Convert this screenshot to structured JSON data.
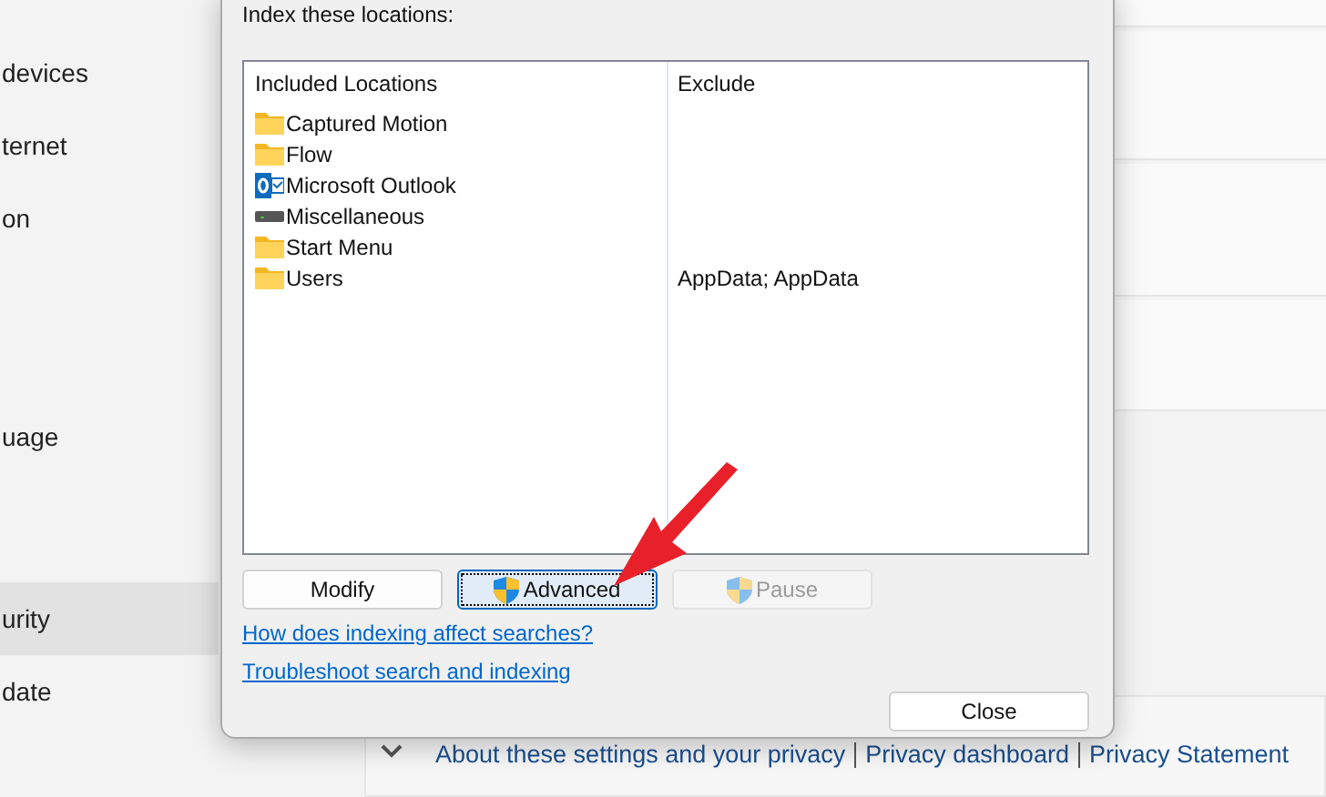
{
  "sidebar": {
    "items": [
      {
        "label": "devices",
        "selected": false
      },
      {
        "label": "ternet",
        "selected": false
      },
      {
        "label": "on",
        "selected": false
      },
      {
        "label": "uage",
        "selected": false
      },
      {
        "label": "urity",
        "selected": true
      },
      {
        "label": "date",
        "selected": false
      }
    ]
  },
  "dialog": {
    "heading": "Index these locations:",
    "columns": [
      "Included Locations",
      "Exclude"
    ],
    "rows": [
      {
        "kind": "folder",
        "location": "Captured Motion",
        "exclude": ""
      },
      {
        "kind": "folder",
        "location": "Flow",
        "exclude": ""
      },
      {
        "kind": "outlook",
        "location": "Microsoft Outlook",
        "exclude": ""
      },
      {
        "kind": "drive",
        "location": "Miscellaneous",
        "exclude": ""
      },
      {
        "kind": "folder",
        "location": "Start Menu",
        "exclude": ""
      },
      {
        "kind": "folder",
        "location": "Users",
        "exclude": "AppData; AppData"
      }
    ],
    "buttons": [
      {
        "label": "Modify",
        "shield": false,
        "disabled": false,
        "focused": false
      },
      {
        "label": "Advanced",
        "shield": true,
        "disabled": false,
        "focused": true
      },
      {
        "label": "Pause",
        "shield": true,
        "disabled": true,
        "focused": false
      }
    ],
    "links": [
      "How does indexing affect searches?",
      "Troubleshoot search and indexing"
    ],
    "close_button": "Close"
  },
  "footer_links": [
    "About these settings and your privacy",
    "Privacy dashboard",
    "Privacy Statement"
  ]
}
